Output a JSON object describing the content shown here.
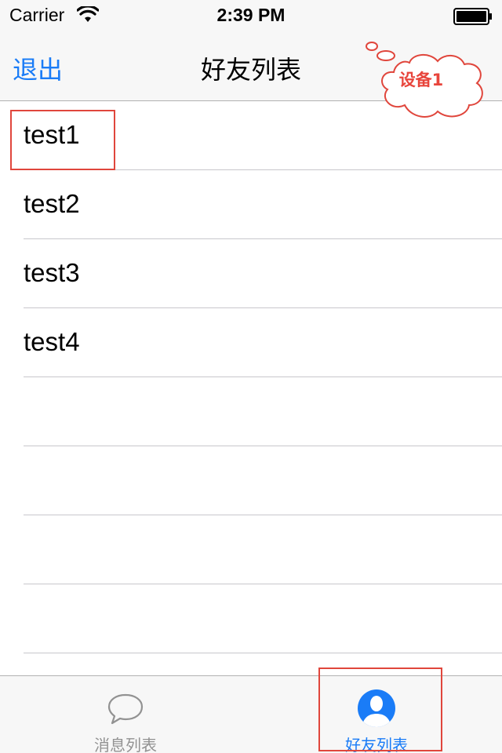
{
  "status_bar": {
    "carrier": "Carrier",
    "time": "2:39 PM"
  },
  "nav": {
    "back_label": "退出",
    "title": "好友列表"
  },
  "annotation": {
    "device_label": "设备1"
  },
  "friends": [
    {
      "name": "test1"
    },
    {
      "name": "test2"
    },
    {
      "name": "test3"
    },
    {
      "name": "test4"
    }
  ],
  "tab_bar": {
    "tabs": [
      {
        "label": "消息列表",
        "icon": "chat-bubble-icon",
        "selected": false
      },
      {
        "label": "好友列表",
        "icon": "contact-person-icon",
        "selected": true
      }
    ]
  },
  "colors": {
    "accent": "#1a7cf7",
    "annotation": "#e0463c",
    "bar_background": "#f7f7f7",
    "separator": "#c8c7cc"
  }
}
